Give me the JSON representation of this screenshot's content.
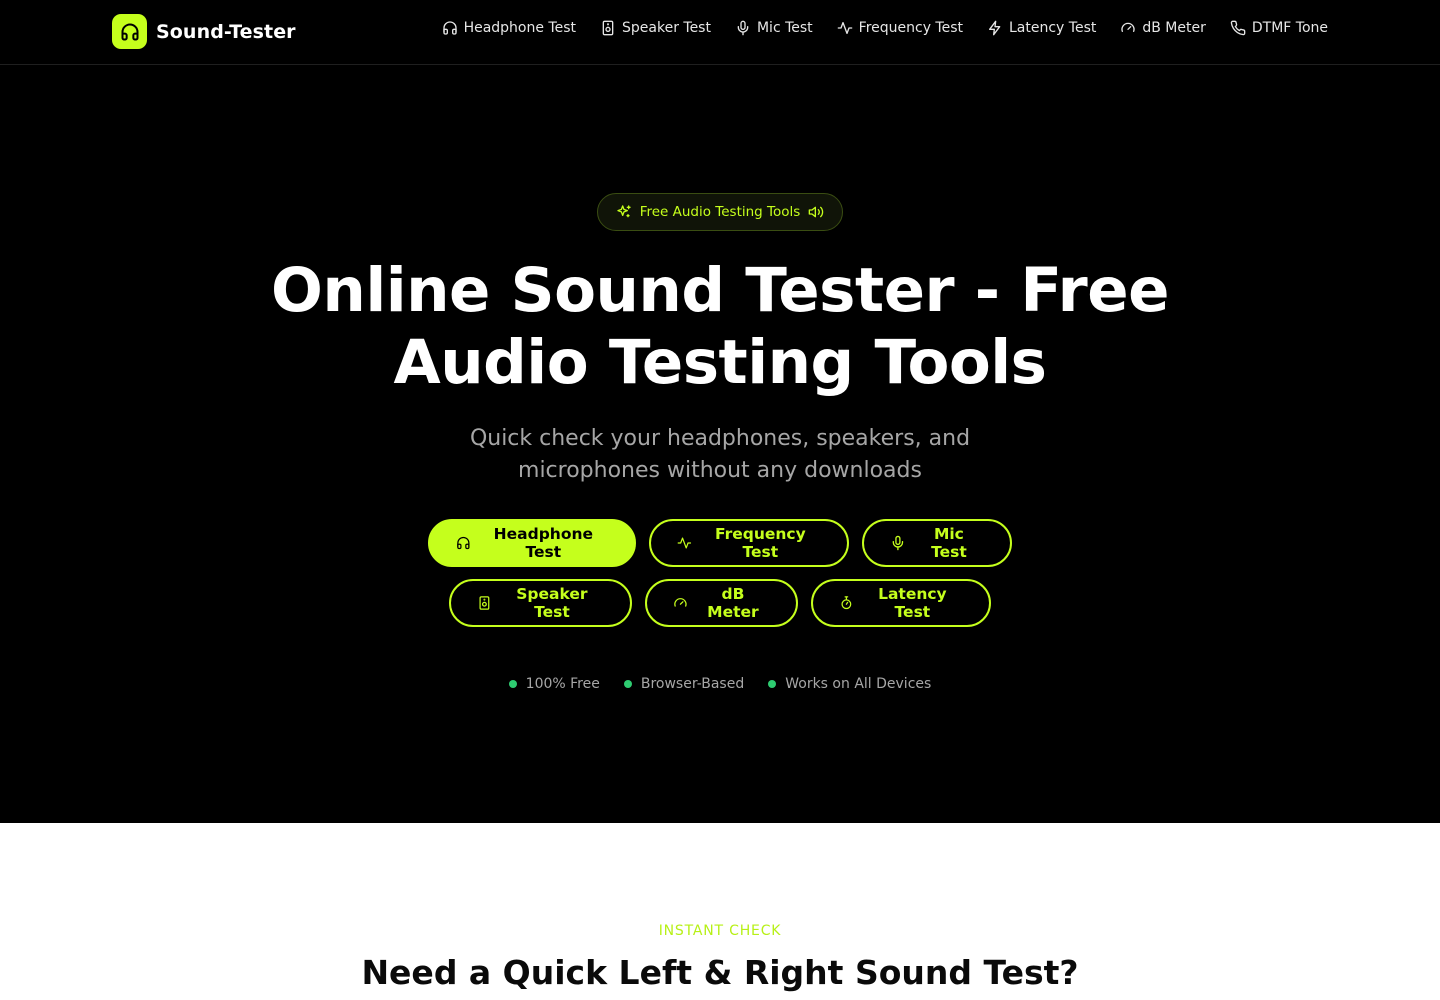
{
  "brand": {
    "name": "Sound-Tester",
    "icon": "headphones-icon",
    "accent": "#c5ff1c"
  },
  "nav": {
    "items": [
      {
        "label": "Headphone Test",
        "icon": "headphones-icon"
      },
      {
        "label": "Speaker Test",
        "icon": "speaker-icon"
      },
      {
        "label": "Mic Test",
        "icon": "mic-icon"
      },
      {
        "label": "Frequency Test",
        "icon": "activity-icon"
      },
      {
        "label": "Latency Test",
        "icon": "zap-icon"
      },
      {
        "label": "dB Meter",
        "icon": "gauge-icon"
      },
      {
        "label": "DTMF Tone",
        "icon": "phone-icon"
      }
    ]
  },
  "hero": {
    "badge": "Free Audio Testing Tools",
    "title_line1": "Online Sound Tester - Free",
    "title_line2": "Audio Testing Tools",
    "subtitle_line1": "Quick check your headphones, speakers, and",
    "subtitle_line2": "microphones without any downloads",
    "buttons_row1": [
      {
        "label": "Headphone Test",
        "icon": "headphones-icon",
        "style": "primary"
      },
      {
        "label": "Frequency Test",
        "icon": "activity-icon",
        "style": "outline"
      },
      {
        "label": "Mic Test",
        "icon": "mic-icon",
        "style": "outline"
      }
    ],
    "buttons_row2": [
      {
        "label": "Speaker Test",
        "icon": "speaker-icon",
        "style": "outline"
      },
      {
        "label": "dB Meter",
        "icon": "gauge-icon",
        "style": "outline"
      },
      {
        "label": "Latency Test",
        "icon": "timer-icon",
        "style": "outline"
      }
    ],
    "features": [
      "100% Free",
      "Browser-Based",
      "Works on All Devices"
    ],
    "feature_dot_color": "#2ecc71"
  },
  "section": {
    "eyebrow": "INSTANT CHECK",
    "title": "Need a Quick Left & Right Sound Test?"
  }
}
